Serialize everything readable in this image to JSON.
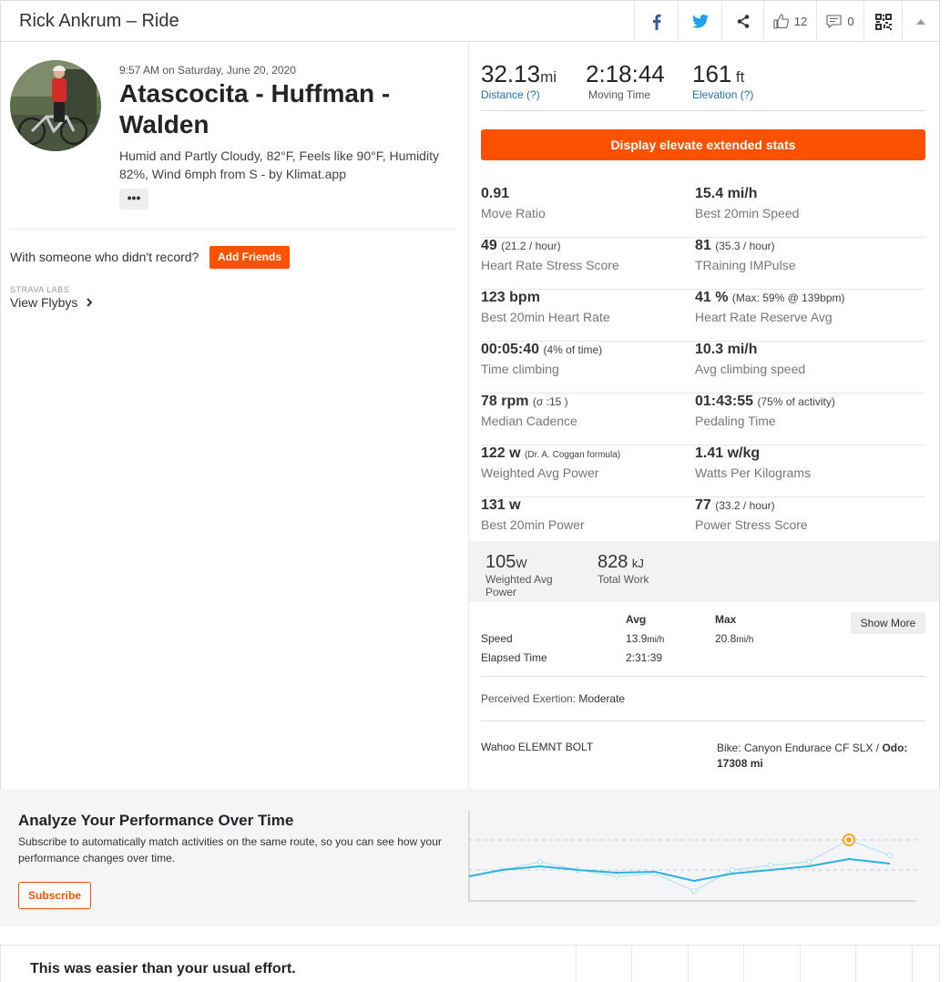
{
  "header": {
    "title": "Rick Ankrum – Ride",
    "kudos_count": "12",
    "comment_count": "0"
  },
  "activity": {
    "datetime": "9:57 AM on Saturday, June 20, 2020",
    "title": "Atascocita - Huffman - Walden",
    "weather": "Humid and Partly Cloudy, 82°F, Feels like 90°F, Humidity 82%, Wind 6mph from S - by Klimat.app",
    "more_label": "•••"
  },
  "friends": {
    "prompt": "With someone who didn't record?",
    "button": "Add Friends"
  },
  "labs": {
    "label": "STRAVA LABS",
    "flybys": "View Flybys"
  },
  "summary": {
    "distance": {
      "value": "32.13",
      "unit": "mi",
      "label": "Distance (?)"
    },
    "moving_time": {
      "value": "2:18:44",
      "label": "Moving Time"
    },
    "elevation": {
      "value": "161",
      "unit": "ft",
      "label": "Elevation (?)"
    }
  },
  "elevate_button": "Display elevate extended stats",
  "extended_stats": [
    {
      "left": {
        "value": "0.91",
        "sub": "",
        "label": "Move Ratio"
      },
      "right": {
        "value": "15.4 mi/h",
        "sub": "",
        "label": "Best 20min Speed"
      }
    },
    {
      "left": {
        "value": "49",
        "sub": "(21.2 / hour)",
        "label": "Heart Rate Stress Score"
      },
      "right": {
        "value": "81",
        "sub": "(35.3 / hour)",
        "label": "TRaining IMPulse"
      }
    },
    {
      "left": {
        "value": "123 bpm",
        "sub": "",
        "label": "Best 20min Heart Rate"
      },
      "right": {
        "value": "41 %",
        "sub": "(Max: 59% @ 139bpm)",
        "label": "Heart Rate Reserve Avg"
      }
    },
    {
      "left": {
        "value": "00:05:40",
        "sub": "(4% of time)",
        "label": "Time climbing"
      },
      "right": {
        "value": "10.3 mi/h",
        "sub": "",
        "label": "Avg climbing speed"
      }
    },
    {
      "left": {
        "value": "78 rpm",
        "sub": "(σ :15 )",
        "label": "Median Cadence"
      },
      "right": {
        "value": "01:43:55",
        "sub": "(75% of activity)",
        "label": "Pedaling Time"
      }
    },
    {
      "left": {
        "value": "122 w",
        "sub": "(Dr. A. Coggan formula)",
        "label": "Weighted Avg Power"
      },
      "right": {
        "value": "1.41 w/kg",
        "sub": "",
        "label": "Watts Per Kilograms"
      }
    },
    {
      "left": {
        "value": "131 w",
        "sub": "",
        "label": "Best 20min Power"
      },
      "right": {
        "value": "77",
        "sub": "(33.2 / hour)",
        "label": "Power Stress Score"
      }
    }
  ],
  "power_box": {
    "weighted": {
      "value": "105",
      "unit": "W",
      "label": "Weighted Avg Power"
    },
    "work": {
      "value": "828",
      "unit": "kJ",
      "label": "Total Work"
    }
  },
  "table": {
    "headers": {
      "avg": "Avg",
      "max": "Max"
    },
    "show_more": "Show More",
    "rows": [
      {
        "label": "Speed",
        "avg": "13.9",
        "avg_unit": "mi/h",
        "max": "20.8",
        "max_unit": "mi/h"
      },
      {
        "label": "Elapsed Time",
        "avg": "2:31:39",
        "avg_unit": "",
        "max": "",
        "max_unit": ""
      }
    ]
  },
  "perceived": {
    "label": "Perceived Exertion:",
    "value": "Moderate"
  },
  "device": "Wahoo ELEMNT BOLT",
  "bike": {
    "prefix": "Bike: Canyon Endurace CF SLX / ",
    "odo_label": "Odo:",
    "odo_value": "17308 mi"
  },
  "analyze": {
    "title": "Analyze Your Performance Over Time",
    "description": "Subscribe to automatically match activities on the same route, so you can see how your performance changes over time.",
    "button": "Subscribe"
  },
  "bottom": {
    "text": "This was easier than your usual effort."
  },
  "colors": {
    "brand": "#fc5200",
    "link": "#1a75b5",
    "chart_line": "#2bb3e0",
    "highlight": "#f5a623"
  }
}
